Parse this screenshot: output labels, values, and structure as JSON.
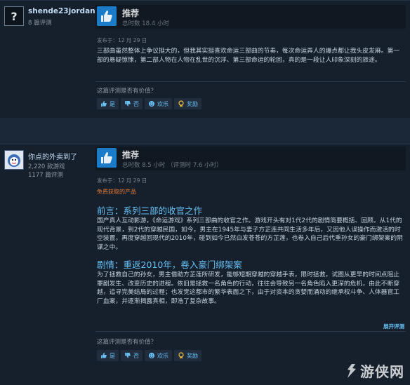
{
  "reviews": [
    {
      "author": {
        "name": "shende23jordan",
        "review_count": "8 篇评测",
        "avatar_glyph": "?"
      },
      "recommendation": "推荐",
      "hours": "总时数 18.4 小时",
      "posted": "发布于：12 月 29 日",
      "body": "三部曲虽然整体上争议挺大的，但我其实挺喜欢命运三部曲的节奏，每次命运弄人的爆点都让我头皮发麻。第一部的悬疑惊悚，第二部人物在人物在乱世的沉浮、第三部命运的轮回，真的是一段让人印象深刻的旅途。",
      "helpful_question": "这篇评测是否有价值？",
      "buttons": {
        "yes": "是",
        "no": "否",
        "funny": "欢乐",
        "award": "奖励"
      }
    },
    {
      "author": {
        "name": "你点的外卖到了",
        "games": "2,220 款游戏",
        "review_count": "1177 篇评测"
      },
      "recommendation": "推荐",
      "hours": "总时数 8.5 小时 （评测时 7.6 小时）",
      "posted": "发布于：12 月 29 日",
      "free_tag": "免费获取的产品",
      "section1_title": "前言：系列三部的收官之作",
      "section1_body": "国产真人互动影游，《命运游戏》系列三部曲的收官之作。游戏开头有对1代2代的剧情简要概括、回顾。从1代的现代背景，到2代的穿越民国，如今，男主在1945年与妻子方芷连共同生活多年后，又因他人误操作而激活的时空装置，再度穿越回现代的2010年，碰到如今已然白发苍苍的方芷莲，也卷入自己后代重孙女的豪门绑架案的阴谋之中。",
      "section2_title": "剧情：重返2010年，卷入豪门绑架案",
      "section2_body": "为了拯救自己的孙女，男主借助方芷莲所研发，能够短期穿越的穿越手表，限时拯救，试图从更早的时间点阻止罪剧发生、改变历史的进程。依旧是拯救一名角色的行动，往往会导致另一名角色陷入更深的危机，由此不断穿越，追寻完美结局的过程；也发觉这都市的繁华表面之下，由于对资本的贪婪而涌动的继承权斗争、人体器官工厂血案，并逐渐揭露真相，即浩了复杂故事。",
      "expand": "展开评测",
      "helpful_question": "这篇评测是否有价值？",
      "buttons": {
        "yes": "是",
        "no": "否",
        "funny": "欢乐",
        "award": "奖励"
      }
    }
  ],
  "watermark": "游侠网",
  "colors": {
    "bg": "#1b2838",
    "panel": "#16202d",
    "link": "#67c1f5",
    "thumb": "#1a7cc8",
    "free": "#e87b31"
  }
}
